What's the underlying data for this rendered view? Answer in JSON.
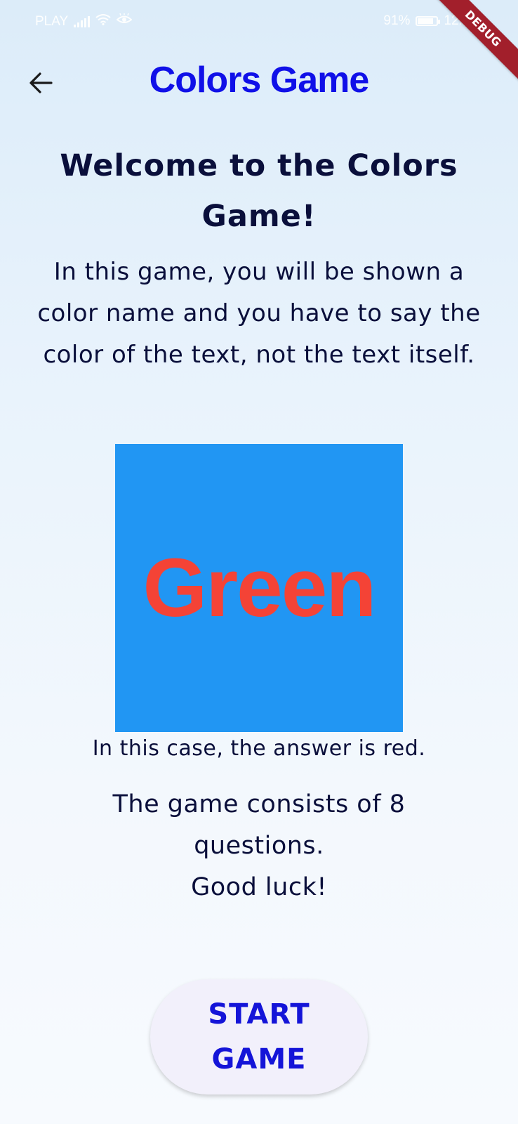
{
  "status_bar": {
    "carrier": "PLAY",
    "battery_percent": "91%",
    "battery_level": 0.91,
    "time": "12:22"
  },
  "debug_banner": "DEBUG",
  "app_bar": {
    "title": "Colors Game",
    "back_icon": "arrow-left-icon"
  },
  "content": {
    "welcome_title": "Welcome to the Colors Game!",
    "intro": "In this game, you will be shown a color name and you have to say the color of the text, not the text itself.",
    "example": {
      "word": "Green",
      "box_color": "#2196f3",
      "word_color": "#f44336"
    },
    "answer_text": "In this case, the answer is red.",
    "game_info_line1": "The game consists of 8 questions.",
    "game_info_line2": "Good luck!"
  },
  "start_button": {
    "label": "START GAME"
  },
  "colors": {
    "title_blue": "#1010e8",
    "text_dark": "#0a0f3b",
    "button_label": "#1414d8",
    "button_bg": "#f2f0fb"
  }
}
